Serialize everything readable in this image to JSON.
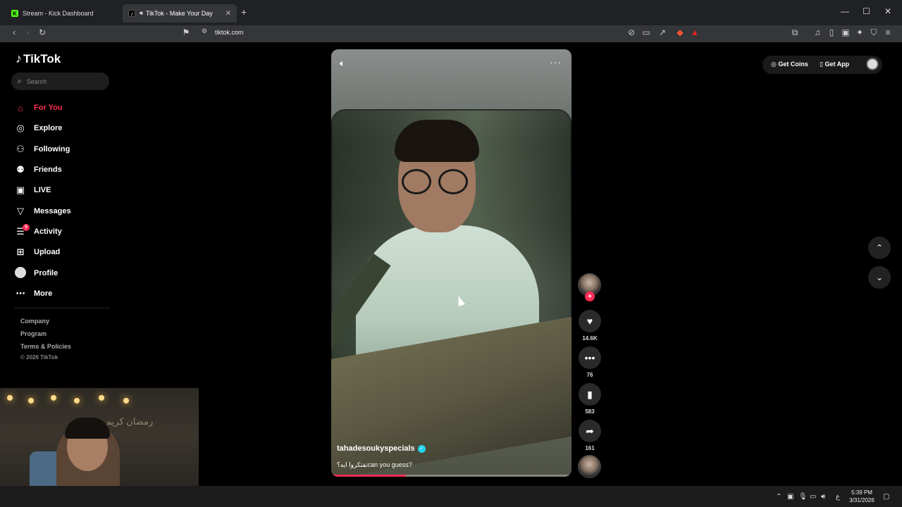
{
  "browser": {
    "tabs": [
      {
        "title": "Stream - Kick Dashboard",
        "active": false,
        "favicon": "K"
      },
      {
        "title": "TikTok - Make Your Day",
        "active": true,
        "favicon": "♪"
      }
    ],
    "url": "tiktok.com"
  },
  "sidebar": {
    "logo": "TikTok",
    "search_placeholder": "Search",
    "items": [
      {
        "label": "For You",
        "icon": "home-icon",
        "active": true
      },
      {
        "label": "Explore",
        "icon": "compass-icon",
        "active": false
      },
      {
        "label": "Following",
        "icon": "user-follow-icon",
        "active": false
      },
      {
        "label": "Friends",
        "icon": "friends-icon",
        "active": false
      },
      {
        "label": "LIVE",
        "icon": "live-icon",
        "active": false
      },
      {
        "label": "Messages",
        "icon": "message-icon",
        "active": false
      },
      {
        "label": "Activity",
        "icon": "activity-icon",
        "active": false,
        "badge": "5"
      },
      {
        "label": "Upload",
        "icon": "upload-icon",
        "active": false
      },
      {
        "label": "Profile",
        "icon": "profile-icon",
        "active": false
      },
      {
        "label": "More",
        "icon": "more-icon",
        "active": false
      }
    ],
    "footer": {
      "company": "Company",
      "program": "Program",
      "terms": "Terms & Policies",
      "copyright": "© 2026 TikTok"
    }
  },
  "video": {
    "author": "tahadesoukyspecials",
    "caption": "تفتكروا ايه؟can you guess?",
    "progress_fraction": 0.31
  },
  "actions": {
    "likes": "14.6K",
    "comments": "76",
    "saves": "583",
    "shares": "161"
  },
  "topbar": {
    "get_coins": "Get Coins",
    "get_app": "Get App"
  },
  "webcam": {
    "wall_text": "رمضان كريم"
  },
  "taskbar": {
    "time": "5:39 PM",
    "date": "3/31/2026",
    "lang": "ع"
  },
  "colors": {
    "accent": "#fe2c55",
    "verified": "#20d5ec"
  }
}
